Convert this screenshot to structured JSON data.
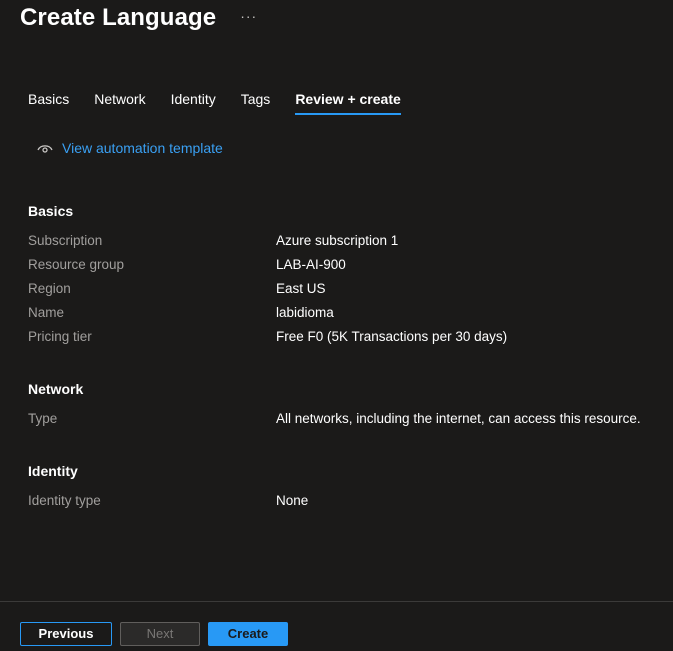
{
  "header": {
    "title": "Create Language",
    "more": "···"
  },
  "tabs": [
    {
      "label": "Basics"
    },
    {
      "label": "Network"
    },
    {
      "label": "Identity"
    },
    {
      "label": "Tags"
    },
    {
      "label": "Review + create",
      "active": true
    }
  ],
  "automation": {
    "icon": "eye-icon",
    "label": "View automation template"
  },
  "sections": {
    "basics": {
      "title": "Basics",
      "rows": [
        {
          "label": "Subscription",
          "value": "Azure subscription 1"
        },
        {
          "label": "Resource group",
          "value": "LAB-AI-900"
        },
        {
          "label": "Region",
          "value": "East US"
        },
        {
          "label": "Name",
          "value": "labidioma"
        },
        {
          "label": "Pricing tier",
          "value": "Free F0 (5K Transactions per 30 days)"
        }
      ]
    },
    "network": {
      "title": "Network",
      "rows": [
        {
          "label": "Type",
          "value": "All networks, including the internet, can access this resource."
        }
      ]
    },
    "identity": {
      "title": "Identity",
      "rows": [
        {
          "label": "Identity type",
          "value": "None"
        }
      ]
    }
  },
  "footer": {
    "previous": "Previous",
    "next": "Next",
    "create": "Create"
  },
  "colors": {
    "background": "#1b1a19",
    "accent": "#2899f5",
    "link": "#3aa0f3",
    "label": "#a19f9d"
  }
}
